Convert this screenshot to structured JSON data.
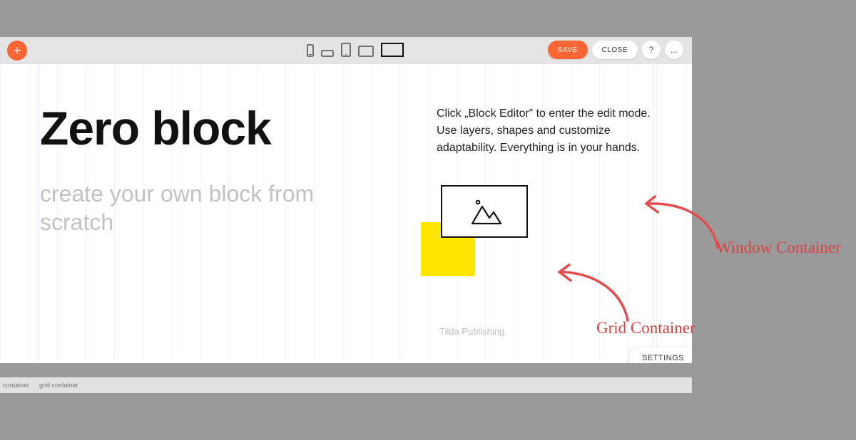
{
  "toolbar": {
    "save_label": "SAVE",
    "close_label": "CLOSE",
    "help_glyph": "?",
    "more_glyph": "...",
    "add_glyph": "+"
  },
  "devices": [
    "mobile-portrait",
    "mobile-landscape",
    "tablet-portrait",
    "tablet-landscape",
    "desktop"
  ],
  "content": {
    "headline": "Zero block",
    "subhead": "create your own block from scratch",
    "body": "Click „Block Editor” to enter the edit mode. Use layers, shapes and customize adaptability. Everything is in your hands.",
    "caption": "Tilda Publishing",
    "settings_label": "SETTINGS"
  },
  "status": {
    "container_label": "container",
    "grid_container_label": "grid container"
  },
  "annotations": {
    "window_container": "Window Container",
    "grid_container": "Grid Container"
  },
  "colors": {
    "accent": "#fb6634",
    "annotation": "#d84242",
    "highlight": "#ffe600"
  }
}
